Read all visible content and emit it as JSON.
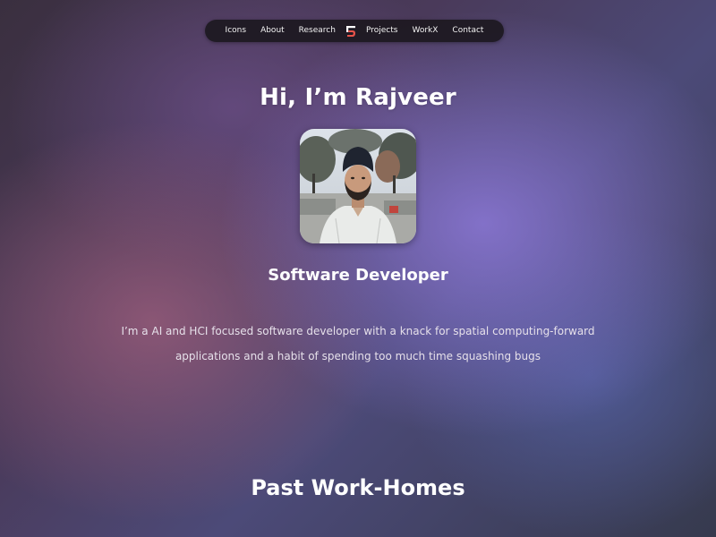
{
  "nav": {
    "items": [
      {
        "label": "Icons"
      },
      {
        "label": "About"
      },
      {
        "label": "Research"
      },
      {
        "label": "Projects"
      },
      {
        "label": "WorkX"
      },
      {
        "label": "Contact"
      }
    ],
    "logo_icon": "brand-logo-icon"
  },
  "hero": {
    "title": "Hi, I’m Rajveer",
    "role": "Software Developer",
    "bio": "I’m a AI and HCI focused software developer with a knack for spatial computing-forward applications and a habit of spending too much time squashing bugs"
  },
  "sections": {
    "past_work_title": "Past Work-Homes"
  },
  "colors": {
    "nav_bg": "#1c1820",
    "logo_accent": "#e8534a",
    "text": "#ffffff"
  }
}
